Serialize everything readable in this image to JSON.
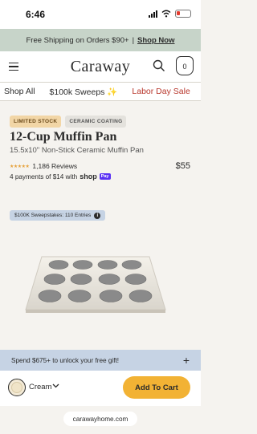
{
  "status": {
    "time": "6:46"
  },
  "promo": {
    "text": "Free Shipping on Orders $90+",
    "separator": "|",
    "link": "Shop Now"
  },
  "header": {
    "logo": "Caraway",
    "cart_count": "0"
  },
  "nav": {
    "items": [
      "Shop All",
      "$100k Sweeps ✨",
      "Labor Day Sale"
    ]
  },
  "product": {
    "badges": [
      "LIMITED STOCK",
      "CERAMIC COATING"
    ],
    "title": "12-Cup Muffin Pan",
    "subtitle": "15.5x10\" Non-Stick Ceramic Muffin Pan",
    "stars": "★★★★★",
    "rating_stars": 5,
    "reviews": "1,186 Reviews",
    "price": "$55",
    "installments": "4 payments of $14 with",
    "shoppay": "shop",
    "pay_pill": "Pay"
  },
  "sweeps": {
    "label": "$100K Sweepstakes: 110 Entries",
    "info": "i"
  },
  "gift": {
    "text": "Spend $675+ to unlock your free gift!",
    "plus": "+"
  },
  "purchase": {
    "color": "Cream",
    "button": "Add To Cart"
  },
  "browser": {
    "url": "carawayhome.com"
  },
  "colors": {
    "promo_bg": "#c7d4c9",
    "accent": "#f2b234",
    "sale": "#b8372c",
    "banner": "#c6d3e4",
    "star": "#e6a23c"
  }
}
